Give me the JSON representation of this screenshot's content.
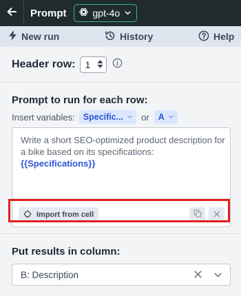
{
  "titlebar": {
    "back_icon": "arrow-left-icon",
    "title": "Prompt",
    "model": {
      "icon": "openai-icon",
      "label": "gpt-4o",
      "chevron": "chevron-down-icon"
    }
  },
  "toolbar": {
    "new_run": {
      "icon": "lightning-icon",
      "label": "New run"
    },
    "history": {
      "icon": "history-icon",
      "label": "History"
    },
    "help": {
      "icon": "help-circle-icon",
      "label": "Help"
    }
  },
  "header_row": {
    "label": "Header row:",
    "value": "1"
  },
  "prompt": {
    "title": "Prompt to run for each row:",
    "insert_label": "Insert variables:",
    "chips": [
      "Specific...",
      "A"
    ],
    "or_text": "or",
    "text": "Write a short SEO-optimized product description for a bike based on its specifications: ",
    "variable": "{{Specifications}}",
    "import_label": "Import from cell"
  },
  "results": {
    "title": "Put results in column:",
    "selected": "B: Description"
  },
  "colors": {
    "titlebar_bg": "#1f2b2c",
    "toolbar_bg": "#dfe5ef",
    "accent_green": "#41b883",
    "chip_bg": "#dbe6ff",
    "chip_text": "#2f55d4",
    "highlight": "#e0201f"
  }
}
